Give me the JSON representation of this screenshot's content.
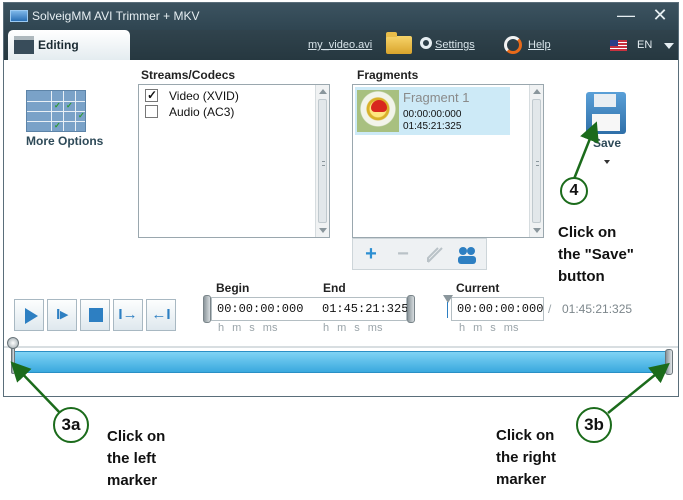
{
  "window": {
    "title": "SolveigMM AVI Trimmer + MKV",
    "minimize_glyph": "—",
    "close_glyph": "✕"
  },
  "menubar": {
    "tab_label": "Editing",
    "file_link": "my_video.avi",
    "settings_link": "Settings",
    "help_link": "Help",
    "language": "EN"
  },
  "more_options": {
    "label": "More Options"
  },
  "streams": {
    "label": "Streams/Codecs",
    "items": [
      {
        "label": "Video (XVID)",
        "checked": true
      },
      {
        "label": "Audio (AC3)",
        "checked": false
      }
    ]
  },
  "fragments": {
    "label": "Fragments",
    "items": [
      {
        "name": "Fragment 1",
        "start": "00:00:00:000",
        "end": "01:45:21:325"
      }
    ]
  },
  "fragment_toolbar": {
    "add_glyph": "+",
    "remove_glyph": "−"
  },
  "save": {
    "label": "Save"
  },
  "times": {
    "begin_label": "Begin",
    "end_label": "End",
    "current_label": "Current",
    "begin": "00:00:00:000",
    "end": "01:45:21:325",
    "current": "00:00:00:000",
    "separator": "/",
    "total": "01:45:21:325",
    "units": [
      "h",
      "m",
      "s",
      "ms"
    ]
  },
  "transport": {
    "mark_in_glyph": "I▸",
    "goto_in_glyph": "I→",
    "goto_out_glyph": "←I"
  },
  "annotations": {
    "callout_4": {
      "number": "4",
      "text": "Click on\nthe \"Save\"\nbutton"
    },
    "callout_3a": {
      "number": "3a",
      "text": "Click on\nthe left\nmarker"
    },
    "callout_3b": {
      "number": "3b",
      "text": "Click on\nthe right\nmarker"
    },
    "arrow_color": "#1b6b1b"
  },
  "colors": {
    "titlebar": "#2f4551",
    "timeline": "#3aa9de",
    "accent_blue": "#2d7fc2",
    "selection": "#cdeaf7"
  }
}
